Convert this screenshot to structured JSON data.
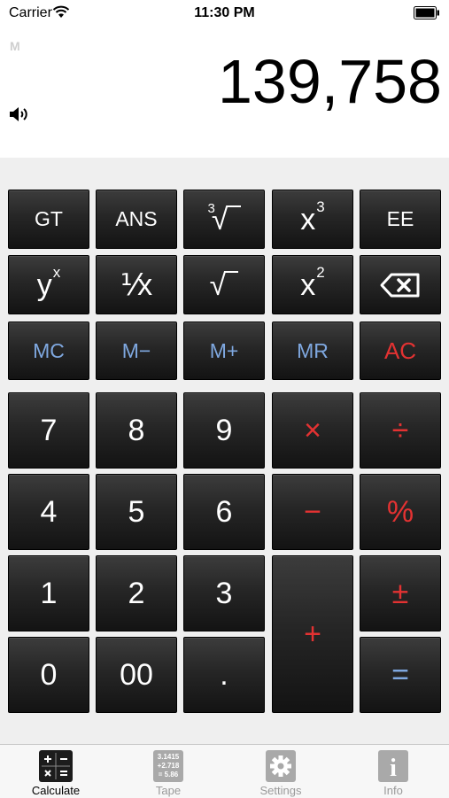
{
  "status_bar": {
    "carrier": "Carrier",
    "time": "11:30 PM"
  },
  "display": {
    "memory_indicator": "M",
    "value": "139,758"
  },
  "keys": {
    "gt": "GT",
    "ans": "ANS",
    "cube_root_index": "3",
    "root_symbol": "√",
    "x_cubed_base": "x",
    "x_cubed_exp": "3",
    "ee": "EE",
    "y_pow_base": "y",
    "y_pow_exp": "x",
    "reciprocal": "⅟x",
    "x_squared_base": "x",
    "x_squared_exp": "2",
    "mc": "MC",
    "m_minus": "M−",
    "m_plus": "M+",
    "mr": "MR",
    "ac": "AC",
    "seven": "7",
    "eight": "8",
    "nine": "9",
    "multiply": "×",
    "divide": "÷",
    "four": "4",
    "five": "5",
    "six": "6",
    "minus": "−",
    "percent": "%",
    "one": "1",
    "two": "2",
    "three": "3",
    "plus": "+",
    "plus_minus": "±",
    "zero": "0",
    "double_zero": "00",
    "decimal": ".",
    "equals": "="
  },
  "tabs": [
    {
      "label": "Calculate",
      "icon": "calculator-icon",
      "active": true
    },
    {
      "label": "Tape",
      "icon": "tape-icon",
      "icon_text": [
        "3.1415",
        "+2.718",
        "= 5.86"
      ]
    },
    {
      "label": "Settings",
      "icon": "gear-icon"
    },
    {
      "label": "Info",
      "icon": "info-icon",
      "icon_text": "i"
    }
  ],
  "colors": {
    "key_face": "#262626",
    "memory_blue": "#7fa8e0",
    "operator_red": "#e33232",
    "keypad_bg": "#efefef"
  }
}
